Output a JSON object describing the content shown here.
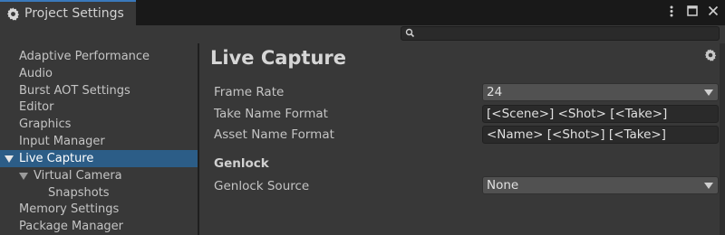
{
  "window": {
    "tab_title": "Project Settings",
    "tab_icon": "gear-icon",
    "controls": [
      "kebab-menu-icon",
      "maximize-icon",
      "close-icon"
    ]
  },
  "search": {
    "placeholder": "",
    "value": ""
  },
  "sidebar": {
    "items": [
      {
        "label": "Adaptive Performance",
        "indent": 0,
        "selected": false,
        "expanded": null
      },
      {
        "label": "Audio",
        "indent": 0,
        "selected": false,
        "expanded": null
      },
      {
        "label": "Burst AOT Settings",
        "indent": 0,
        "selected": false,
        "expanded": null
      },
      {
        "label": "Editor",
        "indent": 0,
        "selected": false,
        "expanded": null
      },
      {
        "label": "Graphics",
        "indent": 0,
        "selected": false,
        "expanded": null
      },
      {
        "label": "Input Manager",
        "indent": 0,
        "selected": false,
        "expanded": null
      },
      {
        "label": "Live Capture",
        "indent": 0,
        "selected": true,
        "expanded": true
      },
      {
        "label": "Virtual Camera",
        "indent": 1,
        "selected": false,
        "expanded": true
      },
      {
        "label": "Snapshots",
        "indent": 2,
        "selected": false,
        "expanded": null
      },
      {
        "label": "Memory Settings",
        "indent": 0,
        "selected": false,
        "expanded": null
      },
      {
        "label": "Package Manager",
        "indent": 0,
        "selected": false,
        "expanded": null
      }
    ],
    "selected_color": "#2c5d87"
  },
  "main": {
    "title": "Live Capture",
    "frame_rate": {
      "label": "Frame Rate",
      "value": "24"
    },
    "take_name_format": {
      "label": "Take Name Format",
      "value": "[<Scene>] <Shot> [<Take>]"
    },
    "asset_name_format": {
      "label": "Asset Name Format",
      "value": "<Name> [<Shot>] [<Take>]"
    },
    "genlock": {
      "header": "Genlock",
      "source": {
        "label": "Genlock Source",
        "value": "None"
      }
    }
  },
  "colors": {
    "accent": "#3a79bb",
    "panel": "#383838",
    "background": "#282828"
  }
}
